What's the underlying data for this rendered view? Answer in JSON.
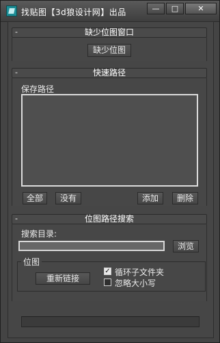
{
  "window": {
    "title": "找贴图【3d狼设计网】出品",
    "min_label": "—",
    "max_label": "□",
    "close_label": "✕"
  },
  "missing_rollout": {
    "toggle": "-",
    "title": "缺少位图窗口",
    "button": "缺少位图"
  },
  "quick_rollout": {
    "toggle": "-",
    "title": "快速路径",
    "save_path_label": "保存路径",
    "btn_all": "全部",
    "btn_none": "没有",
    "btn_add": "添加",
    "btn_delete": "删除"
  },
  "search_rollout": {
    "toggle": "-",
    "title": "位图路径搜索",
    "dir_label": "搜索目录:",
    "dir_value": "",
    "browse": "浏览",
    "group_label": "位图",
    "relink": "重新链接",
    "chk_loop": "循环子文件夹",
    "chk_loop_checked": true,
    "chk_case": "忽略大小写",
    "chk_case_checked": false
  },
  "progress": {
    "value": 0
  },
  "icons": [
    "app-3dsmax-icon",
    "minimize-icon",
    "maximize-icon",
    "close-icon",
    "checkmark-icon"
  ]
}
